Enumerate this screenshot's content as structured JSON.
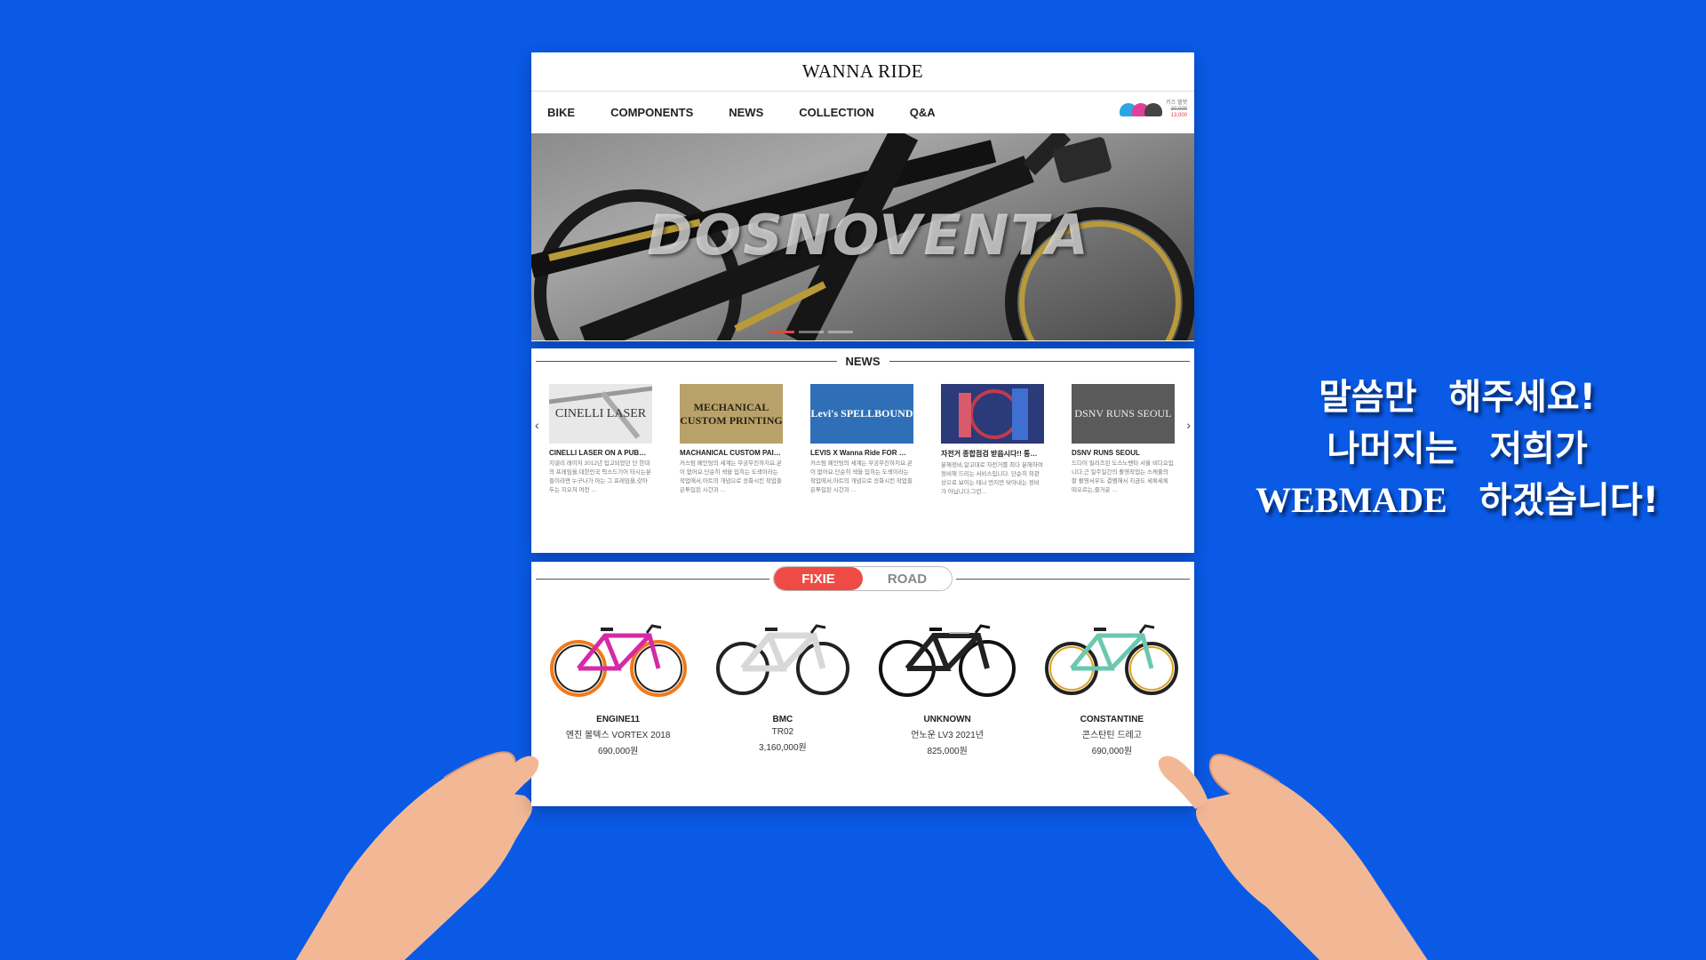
{
  "header": {
    "logo": "WANNA RIDE"
  },
  "nav": {
    "items": [
      "BIKE",
      "COMPONENTS",
      "NEWS",
      "COLLECTION",
      "Q&A"
    ],
    "ad": {
      "label": "키즈 헬멧",
      "old_price": "20,000",
      "price": "13,000"
    }
  },
  "hero": {
    "text": "DOSNOVENTA"
  },
  "news": {
    "title": "NEWS",
    "items": [
      {
        "title": "CINELLI LASER ON A PUB…",
        "body": "지넬리 레이저 2012년 입고되었던 단 한대의 프레임을,대한민국 픽스드기어 타시는분들이라면 누구나가 아는 그 프레임을,갖아두는 지오처 여전 …",
        "thumb_text": "CINELLI LASER",
        "thumb_color": "#e8e8e8"
      },
      {
        "title": "MACHANICAL CUSTOM PAI…",
        "body": "커스텀 페인팅의 세계는 무궁무진하지요.굳이 없어요.단순히 색을 입히는 도색이라는 작업에서,아트의 개념으로 승화시킨 작업들은투입된 시간과 …",
        "thumb_text": "MECHANICAL CUSTOM PRINTING",
        "thumb_color": "#b9a26a"
      },
      {
        "title": "LEVIS X Wanna Ride FOR …",
        "body": "커스텀 페인팅의 세계는 무궁무진하지요.굳이 없어요.단순히 색을 입히는 도색이라는 작업에서,아트의 개념으로 승화시킨 작업들은투입된 시간과 …",
        "thumb_text": "Levi's SPELLBOUND",
        "thumb_color": "#2f6fb8"
      },
      {
        "title": "자전거 종합점검 받읍시다!! 통…",
        "body": "분해정비,알고대로 자전거를 최다 분해하여 정비해 드리는 서비스입니다. 단순히 외관상으로 보이는 테나 먼지만 닦아내는 정비가 아닙니다.그런…",
        "thumb_text": "",
        "thumb_color": "#3a4a8a"
      },
      {
        "title": "DSNV RUNS SEOUL",
        "body": "드디어 릴리즈된 도스노벤타 서울 비디오입니다.근 일주일간의 촬영작업는 스케줄의 잘 촬영서우도 결멤해서 지금도 세록세록 떠오르는,즐거운 …",
        "thumb_text": "DSNV RUNS SEOUL",
        "thumb_color": "#5a5a5a"
      }
    ]
  },
  "shop": {
    "tabs": [
      "FIXIE",
      "ROAD"
    ],
    "active_tab": "FIXIE",
    "products": [
      {
        "brand": "ENGINE11",
        "name": "엔진 볼텍스 VORTEX 2018",
        "price": "690,000원",
        "frame_color": "#d42aa6",
        "accent_color": "#f07a1a"
      },
      {
        "brand": "BMC",
        "name": "TR02",
        "price": "3,160,000원",
        "frame_color": "#f0f0f0",
        "accent_color": "#222222"
      },
      {
        "brand": "UNKNOWN",
        "name": "언노운 LV3 2021년",
        "price": "825,000원",
        "frame_color": "#222222",
        "accent_color": "#bbbbbb"
      },
      {
        "brand": "CONSTANTINE",
        "name": "콘스탄틴 드레고",
        "price": "690,000원",
        "frame_color": "#6ac8b0",
        "accent_color": "#e0a020"
      }
    ]
  },
  "slogan": {
    "line1": "말씀만 해주세요!",
    "line2": "나머지는 저희가",
    "brand": "WEBMADE",
    "line3_rest": "하겠습니다!"
  }
}
